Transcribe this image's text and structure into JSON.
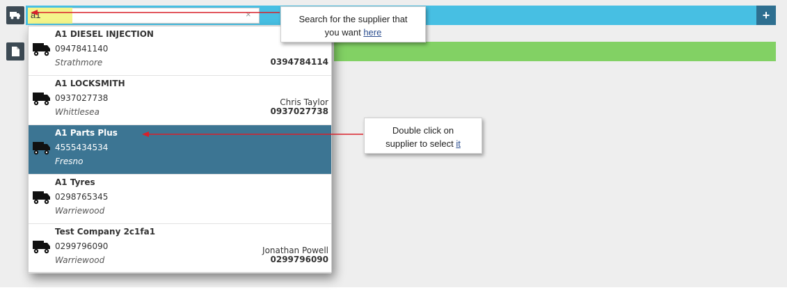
{
  "search": {
    "value": "a1",
    "clear_glyph": "×"
  },
  "icons": {
    "supplier_row": "truck-icon",
    "doc_row": "document-icon",
    "add": "plus-icon"
  },
  "add_button": {
    "glyph": "+"
  },
  "colors": {
    "search_bar": "#47bfe3",
    "add_button": "#2e6f90",
    "green_bar": "#82d164",
    "selected_row": "#3c7593",
    "arrow": "#d9202a",
    "highlight": "#f4f58a"
  },
  "suppliers": [
    {
      "name": "A1 DIESEL INJECTION",
      "phone": "0947841140",
      "city": "Strathmore",
      "contact": "",
      "contact_phone": "0394784114",
      "selected": false
    },
    {
      "name": "A1 LOCKSMITH",
      "phone": "0937027738",
      "city": "Whittlesea",
      "contact": "Chris Taylor",
      "contact_phone": "0937027738",
      "selected": false
    },
    {
      "name": "A1 Parts Plus",
      "phone": "4555434534",
      "city": "Fresno",
      "contact": "",
      "contact_phone": "",
      "selected": true
    },
    {
      "name": "A1 Tyres",
      "phone": "0298765345",
      "city": "Warriewood",
      "contact": "",
      "contact_phone": "",
      "selected": false
    },
    {
      "name": "Test Company 2c1fa1",
      "phone": "0299796090",
      "city": "Warriewood",
      "contact": "Jonathan Powell",
      "contact_phone": "0299796090",
      "selected": false
    }
  ],
  "callouts": {
    "search": {
      "line1": "Search for the supplier that",
      "line2_prefix": "you want ",
      "line2_link": "here"
    },
    "select": {
      "line1": "Double click on",
      "line2_prefix": "supplier to select ",
      "line2_link": "it"
    }
  }
}
